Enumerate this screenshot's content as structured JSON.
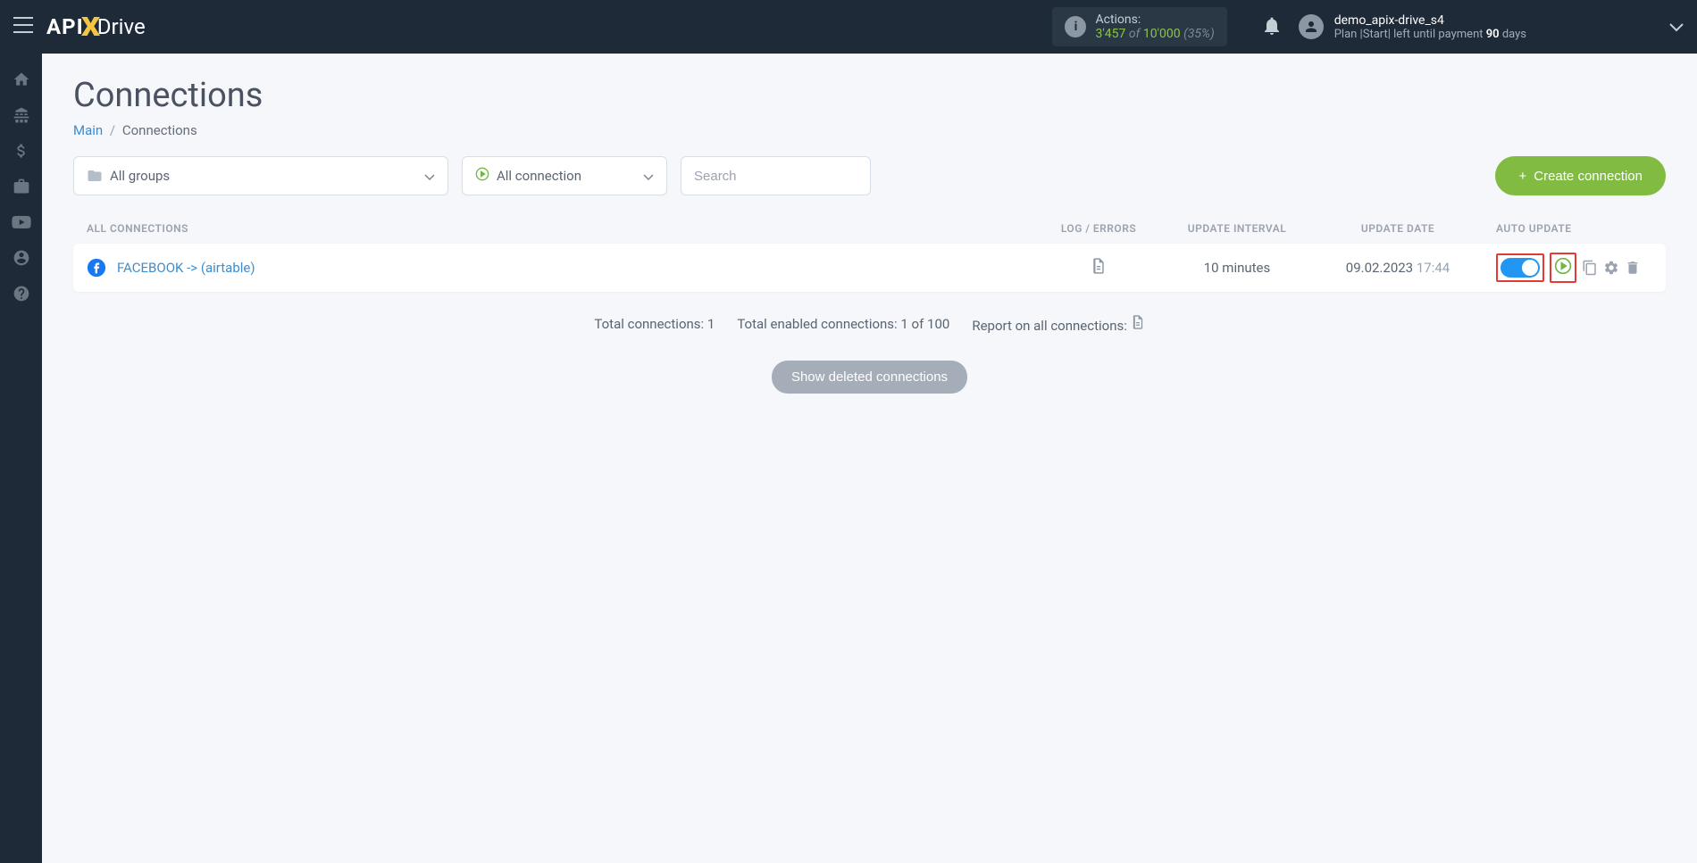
{
  "header": {
    "actions": {
      "label": "Actions:",
      "count": "3'457",
      "of": "of",
      "total": "10'000",
      "pct": "(35%)"
    },
    "user": {
      "name": "demo_apix-drive_s4",
      "plan_prefix": "Plan |Start| left until payment",
      "plan_days": "90",
      "plan_suffix": "days"
    }
  },
  "page": {
    "title": "Connections",
    "breadcrumb_main": "Main",
    "breadcrumb_current": "Connections"
  },
  "filters": {
    "groups": "All groups",
    "status": "All connection",
    "search_placeholder": "Search",
    "create_btn": "Create connection"
  },
  "table": {
    "headers": {
      "name": "ALL CONNECTIONS",
      "log": "LOG / ERRORS",
      "interval": "UPDATE INTERVAL",
      "date": "UPDATE DATE",
      "auto": "AUTO UPDATE"
    },
    "row": {
      "name": "FACEBOOK -> (airtable)",
      "interval": "10 minutes",
      "date": "09.02.2023",
      "time": "17:44"
    }
  },
  "summary": {
    "total": "Total connections: 1",
    "enabled": "Total enabled connections: 1 of 100",
    "report": "Report on all connections:"
  },
  "deleted_btn": "Show deleted connections"
}
